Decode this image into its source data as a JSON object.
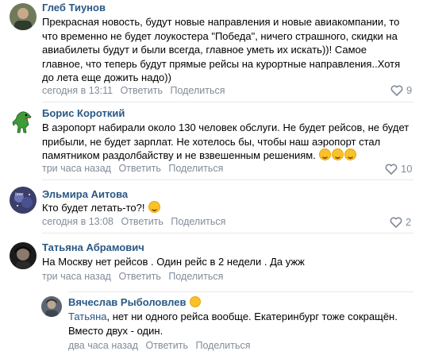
{
  "actions": {
    "reply": "Ответить",
    "share": "Поделиться"
  },
  "colors": {
    "author": "#2a5885",
    "meta": "#818c99",
    "divider": "#e7e8ec"
  },
  "comments": [
    {
      "author": "Глеб Тиунов",
      "lines": [
        "Прекрасная новость, будут новые направления и новые авиакомпании, то",
        "что временно не будет лоукостера \"Победа\", ничего страшного, скидки на",
        "авиабилеты будут и были всегда, главное уметь их искать))! Самое",
        "главное, что теперь будут прямые рейсы на курортные направления..Хотя",
        "до лета еще дожить надо))"
      ],
      "time": "сегодня в 13:11",
      "likes": "9"
    },
    {
      "author": "Борис Короткий",
      "lines": [
        "В аэропорт набирали около 130 человек обслуги. Не будет рейсов, не будет",
        "прибыли, не будет зарплат. Не хотелось бы, чтобы наш аэропорт стал",
        "памятником раздолбайству и не взвешенным решениям."
      ],
      "time": "три часа назад",
      "likes": "10"
    },
    {
      "author": "Эльмира Аитова",
      "lines": [
        "Кто будет летать-то?!"
      ],
      "time": "сегодня в 13:08",
      "likes": "2"
    },
    {
      "author": "Татьяна Абрамович",
      "lines": [
        "На Москву нет рейсов . Один рейс в 2 недели . Да ужж"
      ],
      "time": "три часа назад",
      "likes": ""
    }
  ],
  "reply": {
    "author": "Вячеслав Рыболовлев",
    "reply_to": "Татьяна",
    "lines": [
      ", нет ни одного рейса вообще. Екатеринбург тоже сокращён.",
      "Вместо двух - один."
    ],
    "time": "два часа назад"
  }
}
